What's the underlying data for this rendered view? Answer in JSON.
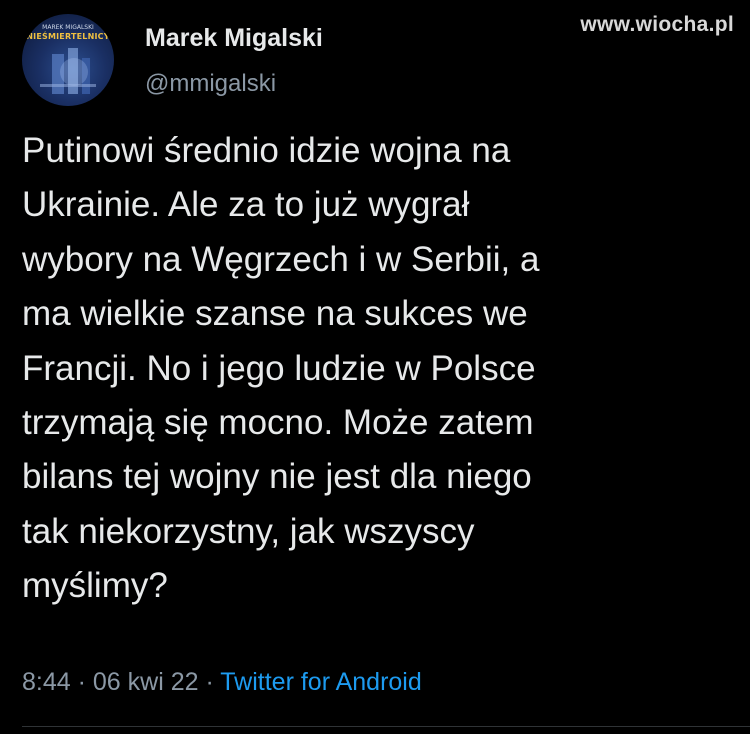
{
  "watermark": "www.wiocha.pl",
  "author": {
    "name": "Marek Migalski",
    "handle": "@mmigalski",
    "avatar_text_top": "MAREK MIGALSKI",
    "avatar_text": "NIEŚMIERTELNICY"
  },
  "tweet": {
    "lines": [
      "Putinowi średnio idzie wojna na",
      "Ukrainie. Ale za to już wygrał",
      "wybory na Węgrzech i w Serbii, a",
      "ma wielkie szanse na sukces we",
      "Francji. No i jego ludzie w Polsce",
      "trzymają się mocno. Może zatem",
      "bilans tej wojny nie jest dla niego",
      "tak niekorzystny, jak wszyscy",
      "myślimy?"
    ]
  },
  "meta": {
    "time": "8:44",
    "separator": " · ",
    "date": "06 kwi 22",
    "source": "Twitter for Android"
  },
  "colors": {
    "background": "#000000",
    "text": "#e7e9ea",
    "muted": "#8b98a5",
    "link": "#1d9bf0"
  }
}
